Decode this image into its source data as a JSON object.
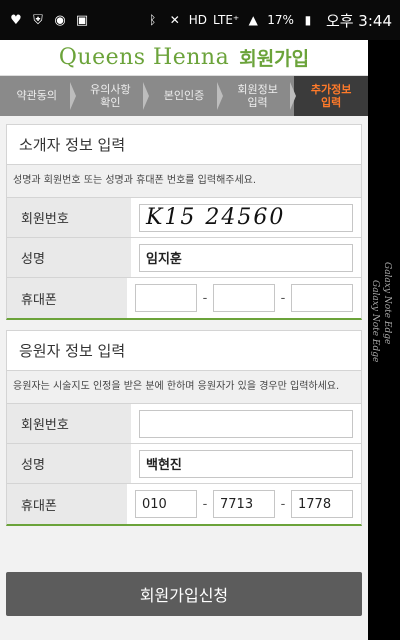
{
  "statusbar": {
    "lte_label": "LTE⁺",
    "hd_label": "HD",
    "battery": "17%",
    "time": "오후 3:44",
    "icons": [
      "heart-icon",
      "shield-icon",
      "media-icon",
      "notification-icon",
      "bluetooth-icon",
      "mute-icon",
      "signal-icon",
      "battery-icon"
    ]
  },
  "header": {
    "brand": "Queens Henna",
    "title": "회원가입"
  },
  "steps": [
    {
      "label": "약관동의"
    },
    {
      "label": "유의사항\n확인"
    },
    {
      "label": "본인인증"
    },
    {
      "label": "회원정보\n입력"
    },
    {
      "label": "추가정보\n입력"
    }
  ],
  "referrer": {
    "title": "소개자 정보 입력",
    "note": "성명과 회원번호 또는 성명과 휴대폰 번호를 입력해주세요.",
    "member_label": "회원번호",
    "member_value": "K15 24560",
    "name_label": "성명",
    "name_value": "임지훈",
    "phone_label": "휴대폰",
    "phone": [
      "",
      "",
      ""
    ]
  },
  "applicant": {
    "title": "응원자 정보 입력",
    "note": "응원자는 시술지도 인정을 받은 분에 한하며 응원자가 있을 경우만 입력하세요.",
    "member_label": "회원번호",
    "member_value": "",
    "name_label": "성명",
    "name_value": "백현진",
    "phone_label": "휴대폰",
    "phone": [
      "010",
      "7713",
      "1778"
    ]
  },
  "submit_label": "회원가입신청",
  "dash": "-",
  "watermark": [
    "Galaxy Note Edge",
    "Galaxy Note Edge"
  ],
  "colors": {
    "accent": "#6ba33a",
    "active_step": "#ff7a2a",
    "step_bar": "#8a8a8a"
  }
}
